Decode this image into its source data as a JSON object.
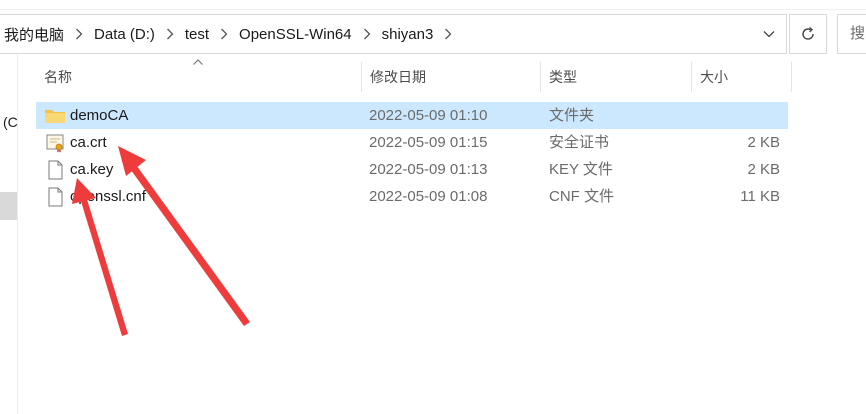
{
  "address_bar": {
    "breadcrumbs": [
      {
        "label": "我的电脑"
      },
      {
        "label": "Data (D:)"
      },
      {
        "label": "test"
      },
      {
        "label": "OpenSSL-Win64"
      },
      {
        "label": "shiyan3"
      }
    ]
  },
  "search": {
    "placeholder": "搜"
  },
  "nav_pane": {
    "partial_label": "(C"
  },
  "columns": {
    "name": "名称",
    "date": "修改日期",
    "type": "类型",
    "size": "大小"
  },
  "files": [
    {
      "name": "demoCA",
      "date": "2022-05-09 01:10",
      "type": "文件夹",
      "size": "",
      "icon": "folder-icon",
      "selected": true
    },
    {
      "name": "ca.crt",
      "date": "2022-05-09 01:15",
      "type": "安全证书",
      "size": "2 KB",
      "icon": "certificate-icon",
      "selected": false
    },
    {
      "name": "ca.key",
      "date": "2022-05-09 01:13",
      "type": "KEY 文件",
      "size": "2 KB",
      "icon": "file-icon",
      "selected": false
    },
    {
      "name": "openssl.cnf",
      "date": "2022-05-09 01:08",
      "type": "CNF 文件",
      "size": "11 KB",
      "icon": "file-icon",
      "selected": false
    }
  ],
  "colors": {
    "selection": "#cce8ff",
    "annotation_arrow": "#ee3b3b",
    "folder": "#f3c24a"
  }
}
